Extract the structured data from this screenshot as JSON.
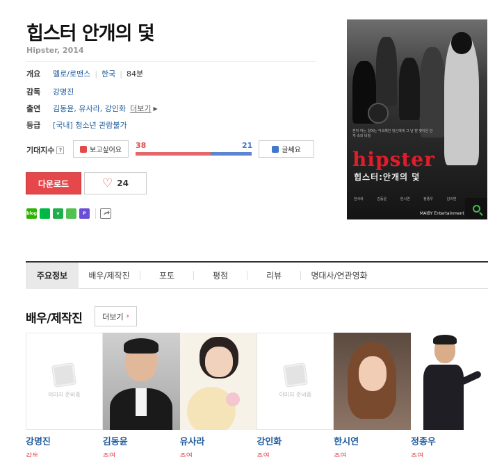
{
  "movie": {
    "title": "힙스터 안개의 덫",
    "subtitle": "Hipster, 2014"
  },
  "info": {
    "overview_label": "개요",
    "genre": "멜로/로맨스",
    "country": "한국",
    "runtime": "84분",
    "director_label": "감독",
    "director": "강명진",
    "cast_label": "출연",
    "cast": "김동윤, 유사라, 강인화",
    "cast_more": "더보기",
    "rating_label": "등급",
    "rating": "[국내] 청소년 관람불가"
  },
  "expectation": {
    "label": "기대지수",
    "help_icon": "question-icon",
    "want_label": "보고싶어요",
    "no_label": "글쎄요",
    "want_count": "38",
    "no_count": "21",
    "want_ratio": 0.644
  },
  "actions": {
    "download_label": "다운로드",
    "like_count": "24"
  },
  "share": {
    "icons": [
      {
        "name": "blog-share-icon",
        "color": "#2db400",
        "text": "blog"
      },
      {
        "name": "band-share-icon",
        "color": "#00b843",
        "text": ""
      },
      {
        "name": "star-share-icon",
        "color": "#1fae4b",
        "text": "★"
      },
      {
        "name": "memo-share-icon",
        "color": "#4fc24f",
        "text": ""
      },
      {
        "name": "p-share-icon",
        "color": "#6a4fd6",
        "text": "P"
      }
    ]
  },
  "poster": {
    "title_word": "hipster",
    "title_kor": "힙스터:안개의 덫",
    "tagline": "혼자 하는 일에는 익숙해진 당신에게 그 날 밤 찾아온 안개 속의 비밀",
    "names": "한사라 김동윤 한시연 정종우 김이연",
    "brand": "MAIBY Entertainment"
  },
  "tabs": [
    "주요정보",
    "배우/제작진",
    "포토",
    "평점",
    "리뷰",
    "명대사/연관영화"
  ],
  "crew": {
    "title": "배우/제작진",
    "more_label": "더보기",
    "placeholder_text": "이미지 준비중",
    "people": [
      {
        "name": "강명진",
        "role": "감독",
        "photo": "none"
      },
      {
        "name": "김동윤",
        "role": "주연",
        "photo": "man-suit"
      },
      {
        "name": "유사라",
        "role": "주연",
        "photo": "woman-bear"
      },
      {
        "name": "강인화",
        "role": "주연",
        "photo": "none"
      },
      {
        "name": "한시연",
        "role": "주연",
        "photo": "woman-hair"
      },
      {
        "name": "정종우",
        "role": "주연",
        "photo": "man-pose"
      }
    ]
  },
  "colors": {
    "accent_red": "#e5474b",
    "link_blue": "#1f5b9c",
    "bar_blue": "#5b86cf"
  }
}
